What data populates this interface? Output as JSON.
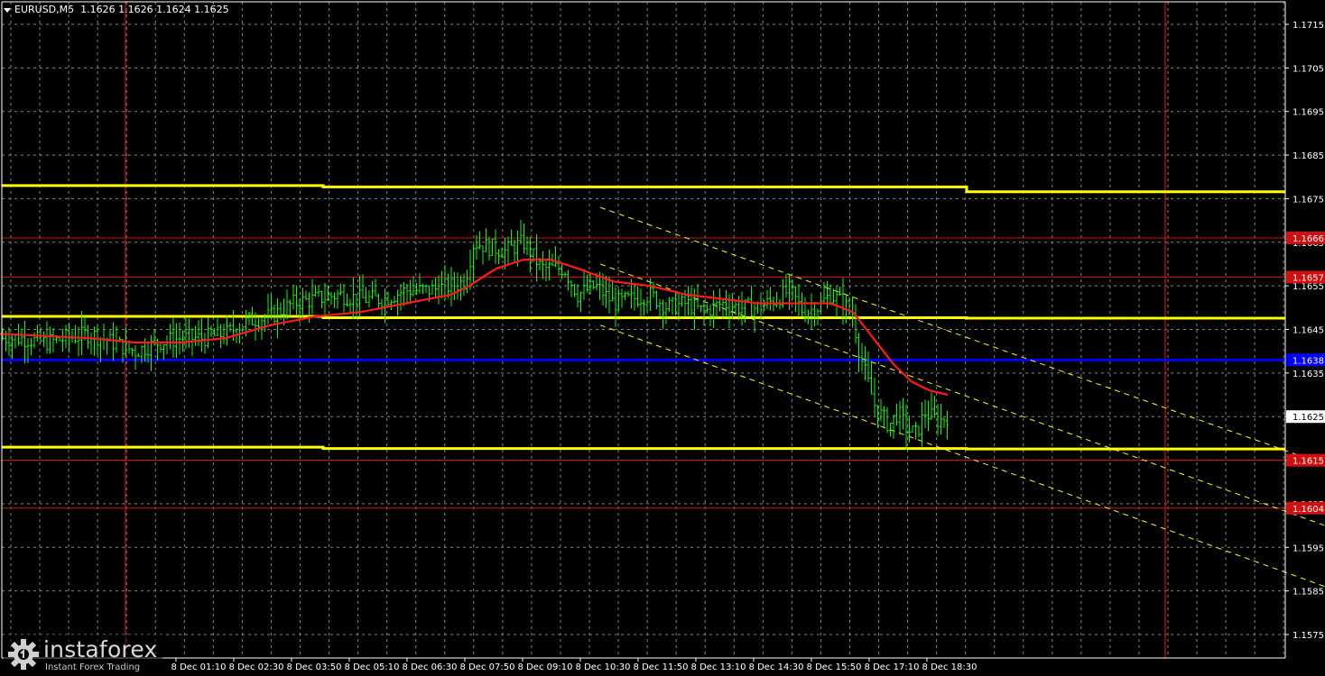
{
  "header": {
    "symbol": "EURUSD,M5",
    "ohlc": "1.1626 1.1626 1.1624 1.1625"
  },
  "branding": {
    "name": "instaforex",
    "tagline": "Instant Forex Trading"
  },
  "colors": {
    "background": "#000000",
    "grid": "#7a8a7a",
    "candles": "#00ff00",
    "moving_average": "#ff1a1a",
    "support_resistance": "#ffff00",
    "pivot_level": "#0000ff",
    "level_line": "#d01010",
    "channel": "#ffff00",
    "axis_text": "#ffffff"
  },
  "chart_data": {
    "type": "candlestick",
    "symbol": "EURUSD",
    "timeframe": "M5",
    "ylim": [
      1.157,
      1.172
    ],
    "y_ticks": [
      1.1575,
      1.1585,
      1.1595,
      1.1605,
      1.1615,
      1.1625,
      1.1635,
      1.1645,
      1.1655,
      1.1665,
      1.1675,
      1.1685,
      1.1695,
      1.1705,
      1.1715
    ],
    "x_tick_labels": [
      "8 Dec 01:10",
      "8 Dec 02:30",
      "8 Dec 03:50",
      "8 Dec 05:10",
      "8 Dec 06:30",
      "8 Dec 07:50",
      "8 Dec 09:10",
      "8 Dec 10:30",
      "8 Dec 11:50",
      "8 Dec 13:10",
      "8 Dec 14:30",
      "8 Dec 15:50",
      "8 Dec 17:10",
      "8 Dec 18:30"
    ],
    "current_price": 1.1625,
    "current_price_label": "1.1625",
    "levels": [
      {
        "value": 1.1666,
        "label": "1.1666",
        "kind": "red-line",
        "color": "#d01010"
      },
      {
        "value": 1.1657,
        "label": "1.1657",
        "kind": "red-line",
        "color": "#d01010"
      },
      {
        "value": 1.1638,
        "label": "1.1638",
        "kind": "blue-line",
        "color": "#0000ff"
      },
      {
        "value": 1.1615,
        "label": "1.1615",
        "kind": "red-line",
        "color": "#d01010"
      },
      {
        "value": 1.1604,
        "label": "1.1604",
        "kind": "red-line",
        "color": "#d01010"
      }
    ],
    "yellow_levels": [
      {
        "left": 1.1678,
        "right": 1.1677
      },
      {
        "left": 1.1648,
        "right": 1.1648
      },
      {
        "left": 1.1618,
        "right": 1.1618
      }
    ],
    "session_markers": [
      "8 Dec 00:00",
      "9 Dec 00:00"
    ],
    "price_path": [
      [
        0,
        1.1643
      ],
      [
        25,
        1.1643
      ],
      [
        50,
        1.1642
      ],
      [
        75,
        1.1643
      ],
      [
        100,
        1.1644
      ],
      [
        125,
        1.1642
      ],
      [
        150,
        1.164
      ],
      [
        175,
        1.1642
      ],
      [
        200,
        1.1643
      ],
      [
        225,
        1.1643
      ],
      [
        250,
        1.1644
      ],
      [
        275,
        1.1647
      ],
      [
        300,
        1.1648
      ],
      [
        325,
        1.1651
      ],
      [
        350,
        1.1652
      ],
      [
        375,
        1.1653
      ],
      [
        400,
        1.1652
      ],
      [
        425,
        1.1652
      ],
      [
        450,
        1.1654
      ],
      [
        475,
        1.1654
      ],
      [
        500,
        1.1655
      ],
      [
        515,
        1.1656
      ],
      [
        525,
        1.1665
      ],
      [
        540,
        1.1664
      ],
      [
        560,
        1.1663
      ],
      [
        580,
        1.1665
      ],
      [
        600,
        1.1659
      ],
      [
        625,
        1.1659
      ],
      [
        640,
        1.1653
      ],
      [
        660,
        1.1655
      ],
      [
        680,
        1.1651
      ],
      [
        700,
        1.1652
      ],
      [
        720,
        1.1653
      ],
      [
        740,
        1.165
      ],
      [
        760,
        1.1651
      ],
      [
        780,
        1.1649
      ],
      [
        800,
        1.1651
      ],
      [
        820,
        1.165
      ],
      [
        840,
        1.165
      ],
      [
        860,
        1.1652
      ],
      [
        875,
        1.1654
      ],
      [
        890,
        1.1649
      ],
      [
        905,
        1.165
      ],
      [
        920,
        1.1653
      ],
      [
        935,
        1.1651
      ],
      [
        945,
        1.1648
      ],
      [
        952,
        1.164
      ],
      [
        960,
        1.1634
      ],
      [
        970,
        1.1627
      ],
      [
        985,
        1.1623
      ],
      [
        995,
        1.1626
      ],
      [
        1005,
        1.1622
      ],
      [
        1015,
        1.1621
      ],
      [
        1025,
        1.1626
      ],
      [
        1040,
        1.1624
      ],
      [
        1050,
        1.1625
      ]
    ],
    "moving_average": [
      [
        0,
        1.1644
      ],
      [
        100,
        1.1643
      ],
      [
        150,
        1.1642
      ],
      [
        200,
        1.1642
      ],
      [
        250,
        1.1643
      ],
      [
        300,
        1.1646
      ],
      [
        350,
        1.1648
      ],
      [
        400,
        1.1649
      ],
      [
        450,
        1.1651
      ],
      [
        500,
        1.1653
      ],
      [
        520,
        1.1655
      ],
      [
        550,
        1.1659
      ],
      [
        580,
        1.1661
      ],
      [
        610,
        1.1661
      ],
      [
        640,
        1.1659
      ],
      [
        680,
        1.1656
      ],
      [
        720,
        1.1655
      ],
      [
        760,
        1.1653
      ],
      [
        800,
        1.1652
      ],
      [
        840,
        1.1651
      ],
      [
        880,
        1.1651
      ],
      [
        920,
        1.1651
      ],
      [
        945,
        1.1649
      ],
      [
        960,
        1.1645
      ],
      [
        975,
        1.1641
      ],
      [
        990,
        1.1637
      ],
      [
        1010,
        1.1633
      ],
      [
        1030,
        1.1631
      ],
      [
        1050,
        1.163
      ]
    ],
    "channel": [
      {
        "p1": [
          665,
          1.1673
        ],
        "p2": [
          1468,
          1.1614
        ]
      },
      {
        "p1": [
          665,
          1.166
        ],
        "p2": [
          1468,
          1.16
        ]
      },
      {
        "p1": [
          665,
          1.1646
        ],
        "p2": [
          1468,
          1.1586
        ]
      }
    ]
  }
}
